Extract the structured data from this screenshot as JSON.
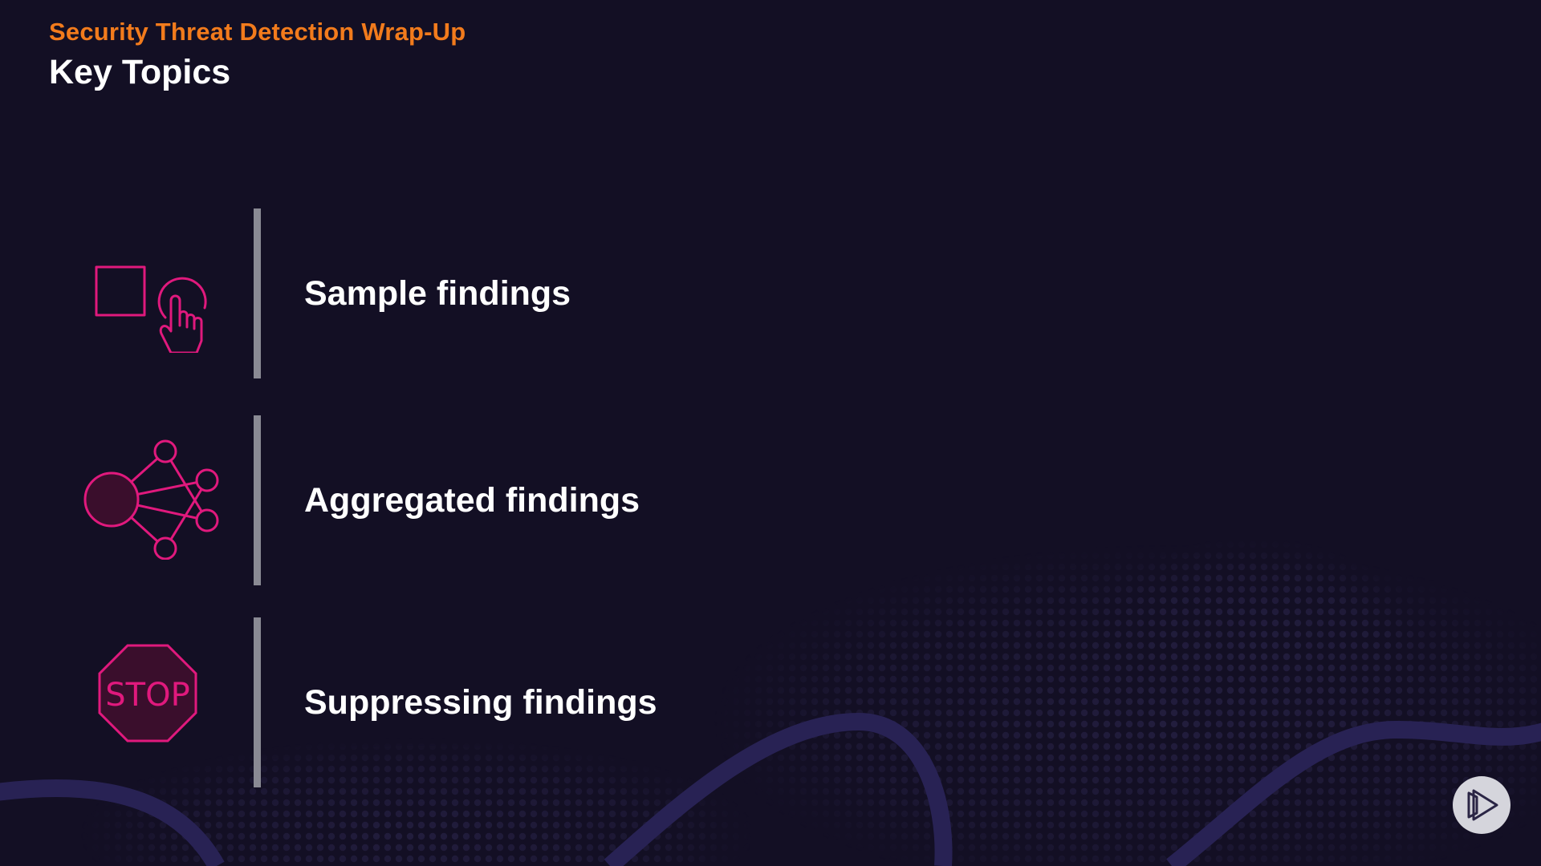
{
  "header": {
    "subtitle": "Security Threat Detection Wrap-Up",
    "title": "Key Topics"
  },
  "topics": [
    {
      "label": "Sample findings",
      "icon": "select-pointer-icon"
    },
    {
      "label": "Aggregated findings",
      "icon": "network-aggregate-icon"
    },
    {
      "label": "Suppressing findings",
      "icon": "stop-sign-icon",
      "icon_text": "STOP"
    }
  ],
  "colors": {
    "background": "#130f24",
    "accent_orange": "#f27b1c",
    "icon_pink": "#e0197d",
    "divider_gray": "#8a8a94",
    "text_white": "#ffffff"
  },
  "player": {
    "icon": "play-logo-icon"
  }
}
